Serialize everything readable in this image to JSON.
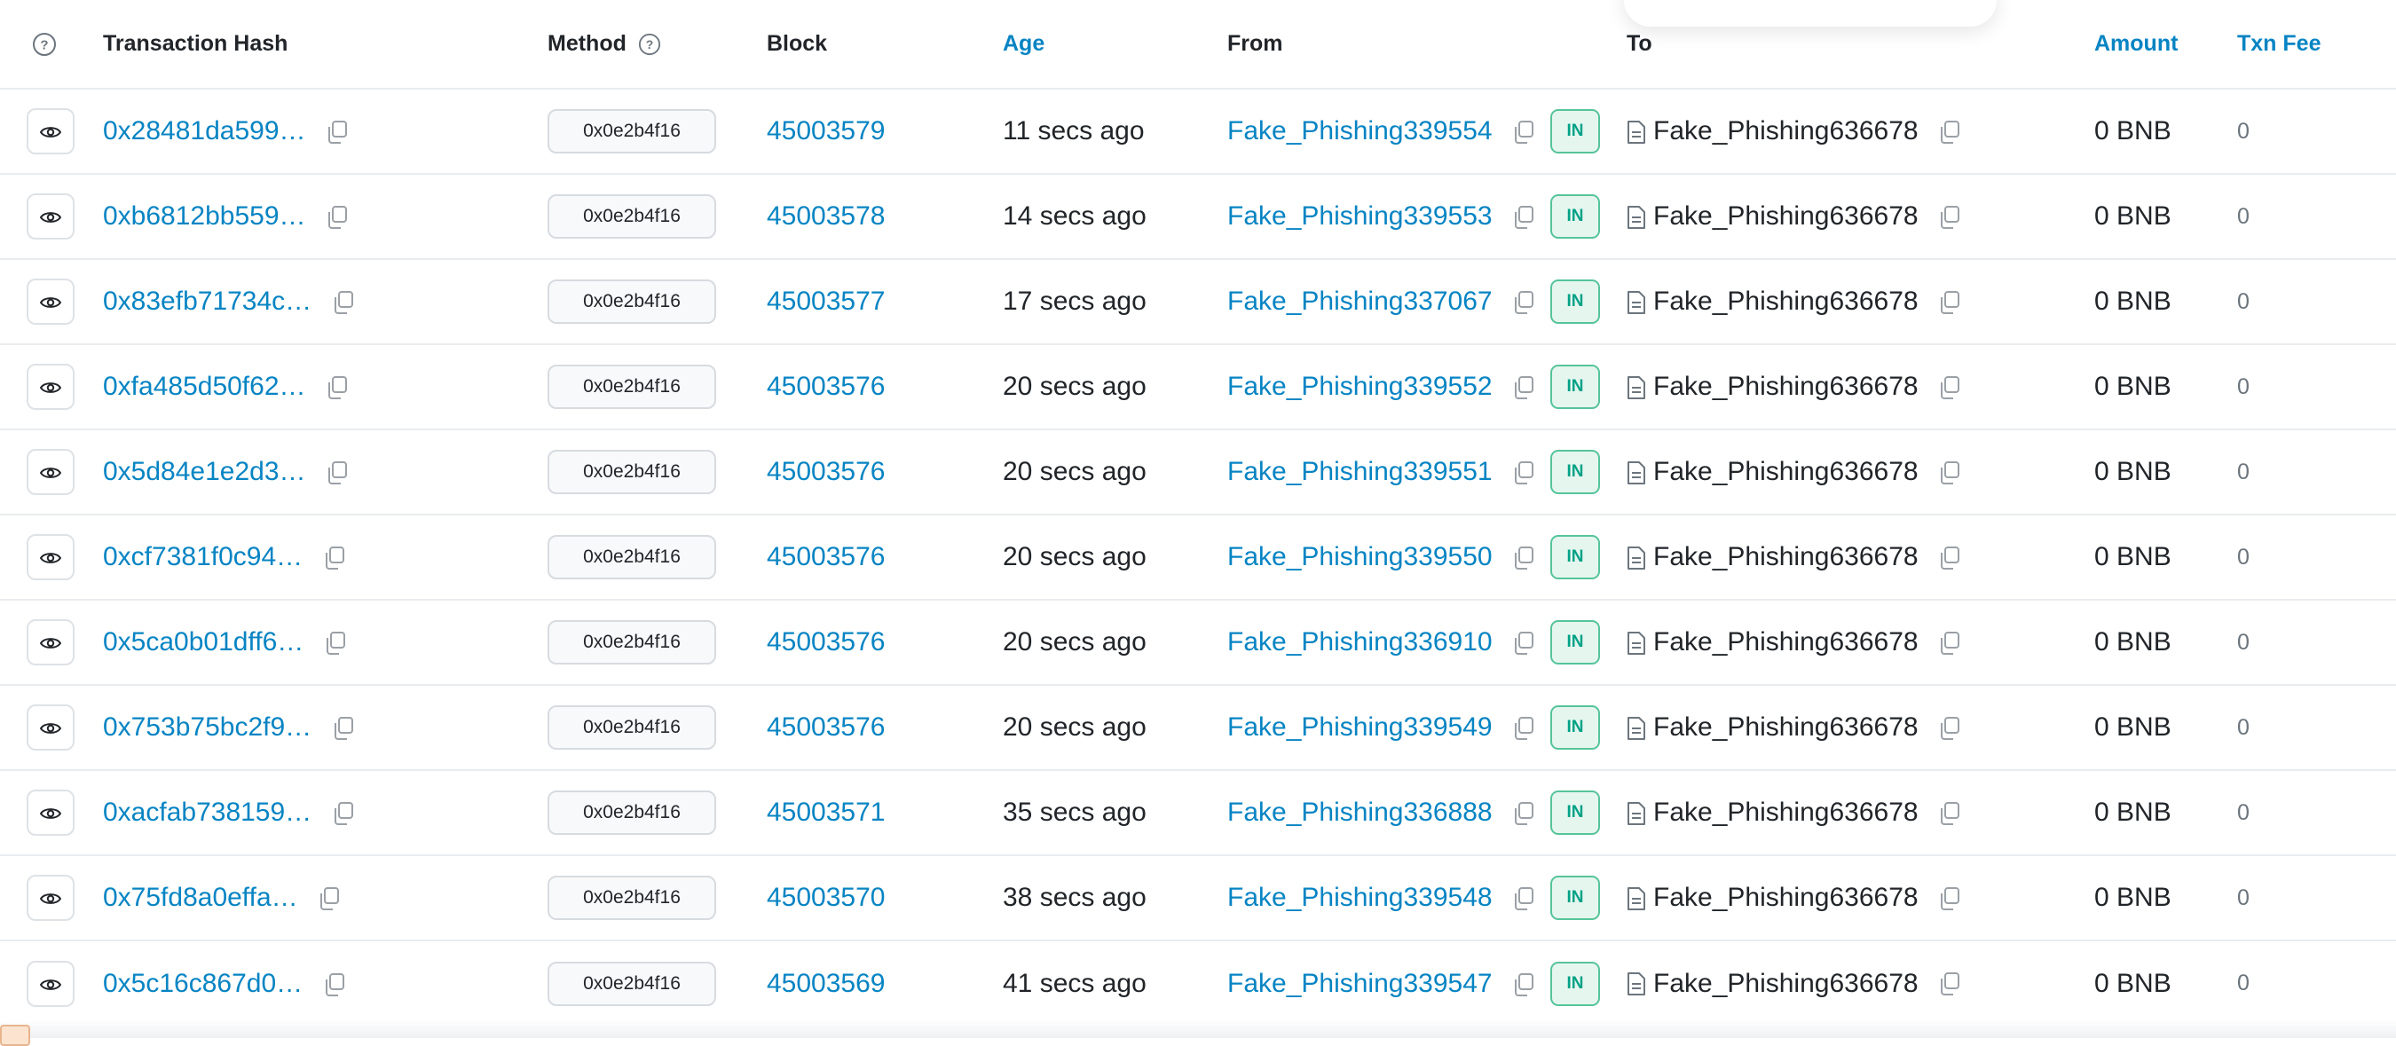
{
  "colors": {
    "link": "#0784c3",
    "in_badge_text": "#00a186",
    "in_badge_bg": "#e5f6ef"
  },
  "headers": {
    "help": "help-circle-icon",
    "hash": "Transaction Hash",
    "method": "Method",
    "block": "Block",
    "age": "Age",
    "from": "From",
    "to": "To",
    "amount": "Amount",
    "fee": "Txn Fee"
  },
  "rows": [
    {
      "hash": "0x28481da599…",
      "method": "0x0e2b4f16",
      "block": "45003579",
      "age": "11 secs ago",
      "from": "Fake_Phishing339554",
      "direction": "IN",
      "to": "Fake_Phishing636678",
      "amount": "0 BNB",
      "fee": "0"
    },
    {
      "hash": "0xb6812bb559…",
      "method": "0x0e2b4f16",
      "block": "45003578",
      "age": "14 secs ago",
      "from": "Fake_Phishing339553",
      "direction": "IN",
      "to": "Fake_Phishing636678",
      "amount": "0 BNB",
      "fee": "0"
    },
    {
      "hash": "0x83efb71734c…",
      "method": "0x0e2b4f16",
      "block": "45003577",
      "age": "17 secs ago",
      "from": "Fake_Phishing337067",
      "direction": "IN",
      "to": "Fake_Phishing636678",
      "amount": "0 BNB",
      "fee": "0"
    },
    {
      "hash": "0xfa485d50f62…",
      "method": "0x0e2b4f16",
      "block": "45003576",
      "age": "20 secs ago",
      "from": "Fake_Phishing339552",
      "direction": "IN",
      "to": "Fake_Phishing636678",
      "amount": "0 BNB",
      "fee": "0"
    },
    {
      "hash": "0x5d84e1e2d3…",
      "method": "0x0e2b4f16",
      "block": "45003576",
      "age": "20 secs ago",
      "from": "Fake_Phishing339551",
      "direction": "IN",
      "to": "Fake_Phishing636678",
      "amount": "0 BNB",
      "fee": "0"
    },
    {
      "hash": "0xcf7381f0c94…",
      "method": "0x0e2b4f16",
      "block": "45003576",
      "age": "20 secs ago",
      "from": "Fake_Phishing339550",
      "direction": "IN",
      "to": "Fake_Phishing636678",
      "amount": "0 BNB",
      "fee": "0"
    },
    {
      "hash": "0x5ca0b01dff6…",
      "method": "0x0e2b4f16",
      "block": "45003576",
      "age": "20 secs ago",
      "from": "Fake_Phishing336910",
      "direction": "IN",
      "to": "Fake_Phishing636678",
      "amount": "0 BNB",
      "fee": "0"
    },
    {
      "hash": "0x753b75bc2f9…",
      "method": "0x0e2b4f16",
      "block": "45003576",
      "age": "20 secs ago",
      "from": "Fake_Phishing339549",
      "direction": "IN",
      "to": "Fake_Phishing636678",
      "amount": "0 BNB",
      "fee": "0"
    },
    {
      "hash": "0xacfab738159…",
      "method": "0x0e2b4f16",
      "block": "45003571",
      "age": "35 secs ago",
      "from": "Fake_Phishing336888",
      "direction": "IN",
      "to": "Fake_Phishing636678",
      "amount": "0 BNB",
      "fee": "0"
    },
    {
      "hash": "0x75fd8a0effa…",
      "method": "0x0e2b4f16",
      "block": "45003570",
      "age": "38 secs ago",
      "from": "Fake_Phishing339548",
      "direction": "IN",
      "to": "Fake_Phishing636678",
      "amount": "0 BNB",
      "fee": "0"
    },
    {
      "hash": "0x5c16c867d0…",
      "method": "0x0e2b4f16",
      "block": "45003569",
      "age": "41 secs ago",
      "from": "Fake_Phishing339547",
      "direction": "IN",
      "to": "Fake_Phishing636678",
      "amount": "0 BNB",
      "fee": "0"
    }
  ]
}
